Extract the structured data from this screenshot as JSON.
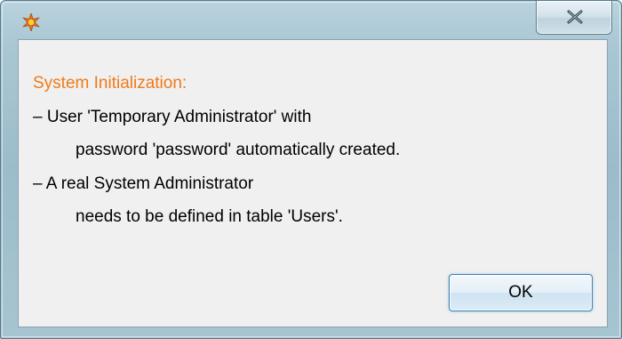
{
  "dialog": {
    "title": "",
    "close_label": "X",
    "message": {
      "heading": "System Initialization:",
      "lines": [
        "– User 'Temporary Administrator' with",
        "password 'password' automatically created.",
        "– A real System Administrator",
        "needs to be defined in table 'Users'."
      ]
    },
    "ok_label": "OK"
  },
  "icons": {
    "app": "starburst-app-icon",
    "close": "close-icon"
  },
  "colors": {
    "heading": "#f07a1a",
    "frame": "#a9c6d3",
    "client": "#f0f0f0",
    "ok_border": "#3c7fb1"
  }
}
